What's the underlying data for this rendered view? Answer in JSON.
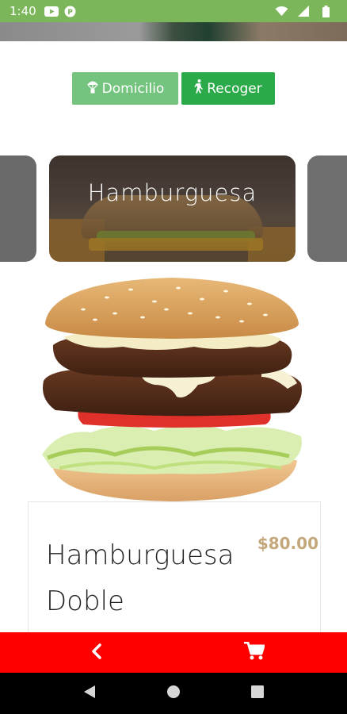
{
  "status_bar": {
    "time": "1:40",
    "icons": [
      "youtube-icon",
      "app-notification-icon",
      "wifi-icon",
      "signal-icon",
      "battery-icon"
    ]
  },
  "order_mode": {
    "delivery_label": "Domicilio",
    "pickup_label": "Recoger",
    "selected": "Recoger"
  },
  "category_carousel": {
    "current_label": "Hamburguesa"
  },
  "product": {
    "name": "Hamburguesa Doble",
    "price": "$80.00"
  },
  "bottom_bar": {
    "back_icon": "chevron-left-icon",
    "cart_icon": "cart-icon"
  },
  "colors": {
    "status_bar": "#7cb65a",
    "delivery_button": "#74c47f",
    "pickup_button": "#2aaa49",
    "price": "#c4a77b",
    "action_bar": "#ff0000"
  }
}
